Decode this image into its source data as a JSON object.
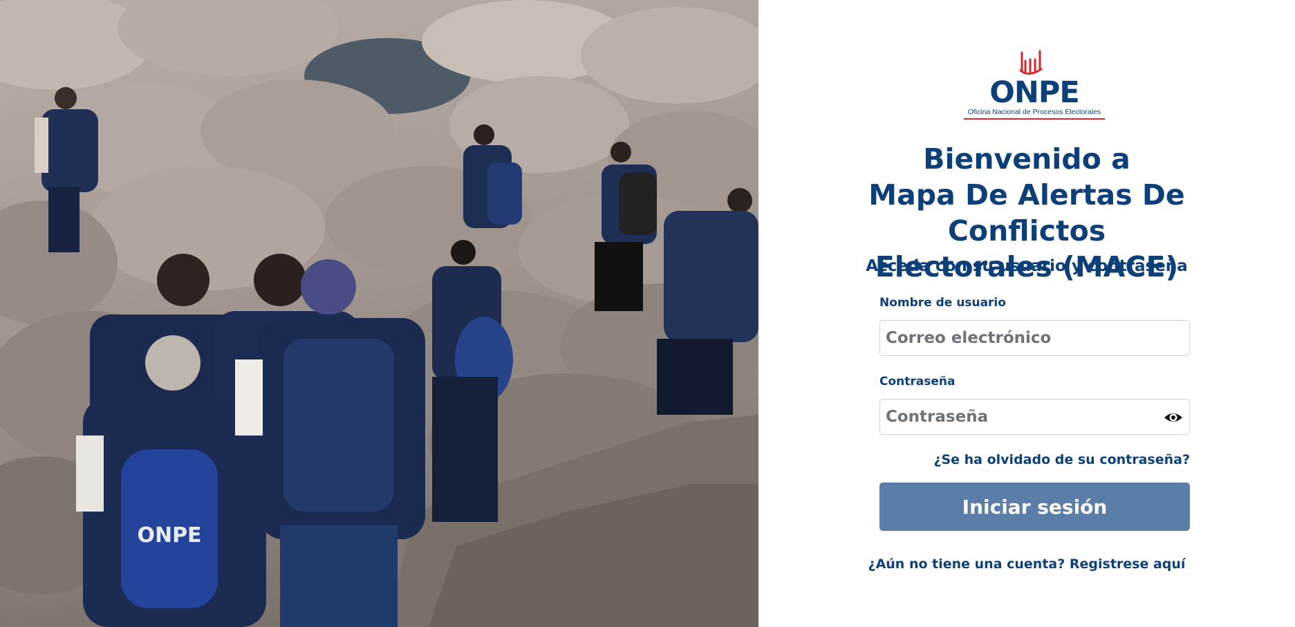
{
  "brand": {
    "name": "ONPE",
    "tagline": "Oficina Nacional de Procesos Electorales",
    "accent_color": "#d7262e",
    "primary_color": "#0d3f78"
  },
  "hero_image": {
    "icon": "photo-of-election-workers-hiking-over-rocks",
    "vest_text": "ONPE"
  },
  "welcome": {
    "line1": "Bienvenido a",
    "line2": "Mapa De Alertas De Conflictos",
    "line3": "Electorales (MACE)"
  },
  "subtitle": "Acceda con su usuario y contraseña",
  "form": {
    "username_label": "Nombre de usuario",
    "username_placeholder": "Correo electrónico",
    "username_value": "",
    "password_label": "Contraseña",
    "password_placeholder": "Contraseña",
    "password_value": "",
    "show_password_icon": "eye-icon",
    "forgot_link": "¿Se ha olvidado de su contraseña?",
    "submit_label": "Iniciar sesión",
    "submit_color": "#5a7ea7"
  },
  "register": {
    "prompt": "¿Aún no tiene una cuenta?",
    "link": "Registrese aquí"
  }
}
